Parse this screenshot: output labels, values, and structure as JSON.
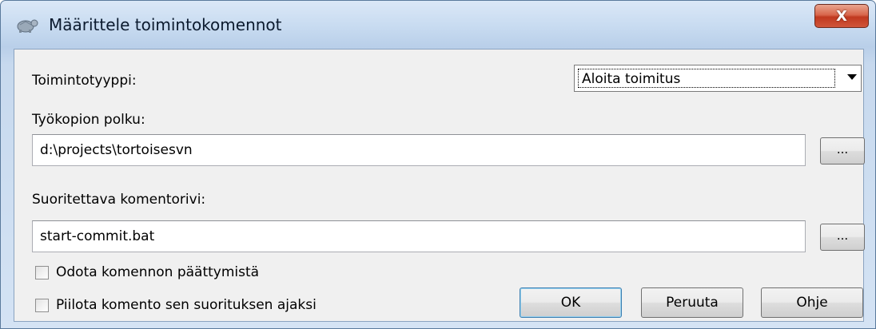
{
  "window": {
    "title": "Määrittele toimintokomennot",
    "close_label": "X"
  },
  "form": {
    "action_type": {
      "label": "Toimintotyyppi:",
      "selected": "Aloita toimitus"
    },
    "working_copy": {
      "label": "Työkopion polku:",
      "value": "d:\\projects\\tortoisesvn",
      "browse_label": "..."
    },
    "command": {
      "label": "Suoritettava komentorivi:",
      "value": "start-commit.bat",
      "browse_label": "..."
    },
    "wait_checkbox": {
      "label": "Odota komennon päättymistä",
      "checked": false
    },
    "hide_checkbox": {
      "label": "Piilota komento sen suorituksen ajaksi",
      "checked": false
    }
  },
  "buttons": {
    "ok": "OK",
    "cancel": "Peruuta",
    "help": "Ohje"
  },
  "icons": {
    "app": "tortoise-icon",
    "close": "close-icon",
    "dropdown": "chevron-down-icon"
  }
}
